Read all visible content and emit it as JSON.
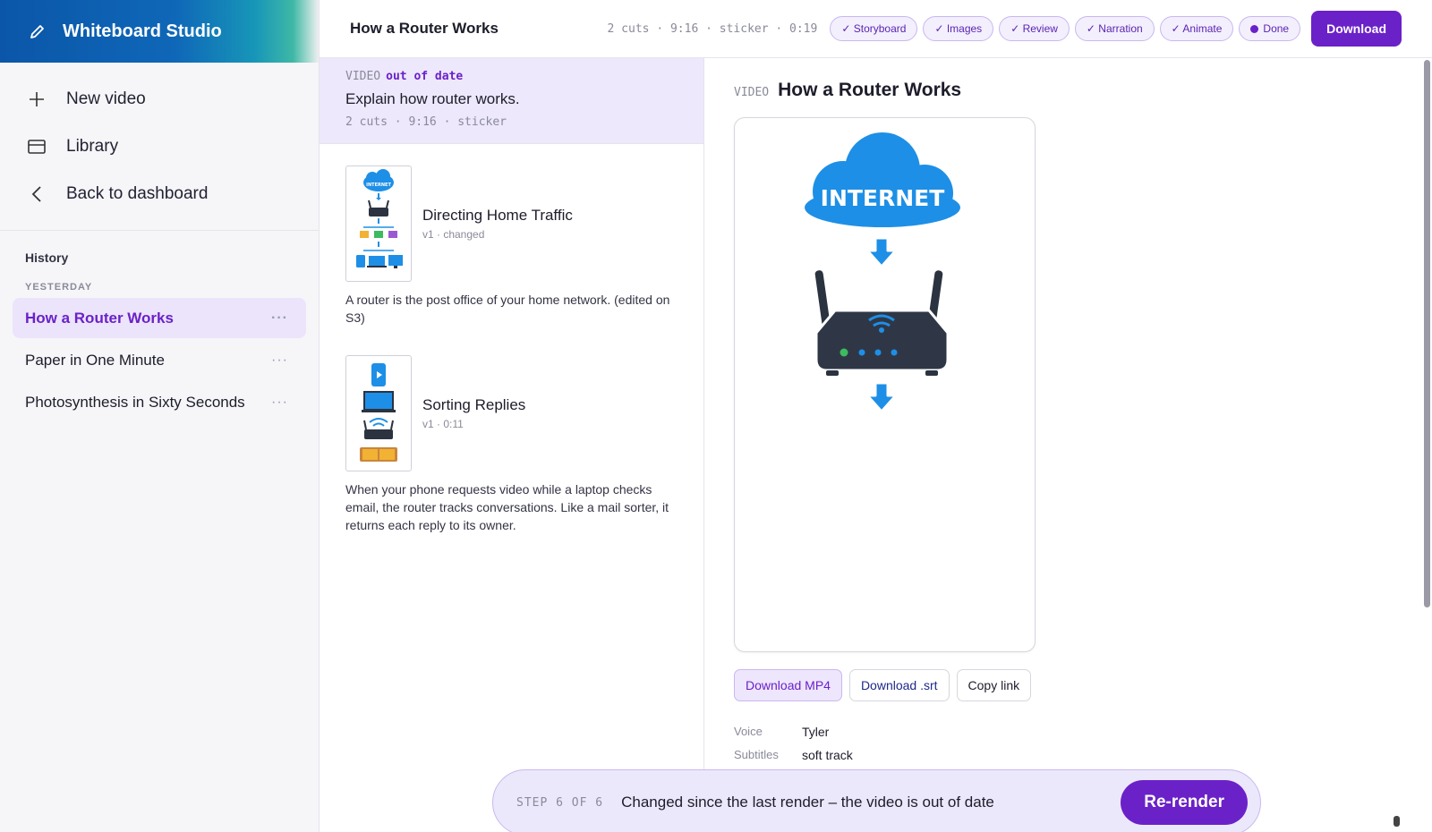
{
  "app": {
    "title": "Whiteboard Studio",
    "icon": "pencil-icon"
  },
  "sidebar": {
    "nav": [
      {
        "label": "New video",
        "icon": "plus-icon"
      },
      {
        "label": "Library",
        "icon": "library-icon"
      },
      {
        "label": "Back to dashboard",
        "icon": "chevron-left-icon"
      }
    ],
    "history_title": "History",
    "group_label": "YESTERDAY",
    "items": [
      {
        "label": "How a Router Works",
        "active": true,
        "more": "···"
      },
      {
        "label": "Paper in One Minute",
        "active": false,
        "more": "···"
      },
      {
        "label": "Photosynthesis in Sixty Seconds",
        "active": false,
        "more": "···"
      }
    ]
  },
  "header": {
    "title": "How a Router Works",
    "meta": "2 cuts · 9:16 · sticker · 0:19",
    "steps": [
      {
        "label": "✓ Storyboard"
      },
      {
        "label": "✓ Images"
      },
      {
        "label": "✓ Review"
      },
      {
        "label": "✓ Narration"
      },
      {
        "label": "✓ Animate"
      },
      {
        "label": "Done"
      }
    ],
    "download_label": "Download"
  },
  "video_card": {
    "kind": "VIDEO",
    "status": "out of date",
    "prompt": "Explain how router works.",
    "meta": "2 cuts · 9:16 · sticker"
  },
  "scenes": [
    {
      "title": "Directing Home Traffic",
      "sub": "v1 · changed",
      "desc": "A router is the post office of your home network. (edited on S3)",
      "thumb_text": "INTERNET"
    },
    {
      "title": "Sorting Replies",
      "sub": "v1 · 0:11",
      "desc": "When your phone requests video while a laptop checks email, the router tracks conversations. Like a mail sorter, it returns each reply to its owner."
    }
  ],
  "preview": {
    "kind": "VIDEO",
    "title": "How a Router Works",
    "cloud_text": "INTERNET",
    "actions": {
      "mp4": "Download MP4",
      "srt": "Download .srt",
      "copy": "Copy link"
    },
    "details": [
      {
        "key": "Voice",
        "value": "Tyler"
      },
      {
        "key": "Subtitles",
        "value": "soft track"
      }
    ]
  },
  "stepbar": {
    "step": "STEP 6 OF 6",
    "message": "Changed since the last render – the video is out of date",
    "button": "Re-render"
  },
  "colors": {
    "accent": "#6b21c8",
    "brand_blue": "#0b56a8",
    "cloud_blue": "#1e8fe6"
  }
}
